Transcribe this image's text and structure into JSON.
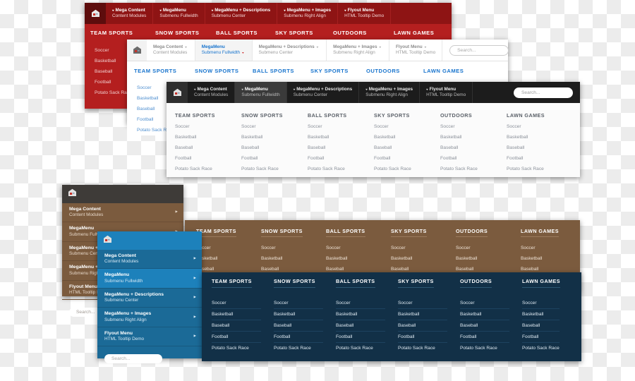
{
  "icons": {
    "home": "home-icon",
    "caret": "▾",
    "arrow": "►"
  },
  "top_items": [
    {
      "t1": "Mega Content",
      "t2": "Content Modules"
    },
    {
      "t1": "MegaMenu",
      "t2": "Submenu Fullwidth"
    },
    {
      "t1": "MegaMenu + Descriptions",
      "t2": "Submenu Center"
    },
    {
      "t1": "MegaMenu + Images",
      "t2": "Submenu Right Align"
    },
    {
      "t1": "Flyout Menu",
      "t2": "HTML Tooltip Demo"
    }
  ],
  "categories": [
    "TEAM SPORTS",
    "SNOW SPORTS",
    "BALL SPORTS",
    "SKY SPORTS",
    "OUTDOORS",
    "LAWN GAMES"
  ],
  "links": [
    "Soccer",
    "Basketball",
    "Baseball",
    "Football",
    "Potato Sack Race"
  ],
  "search": {
    "placeholder": "Search...",
    "label": "Search..."
  },
  "colors": {
    "red": "#b41f1f",
    "red_dark": "#8e1414",
    "blue_link": "#1874cd",
    "dark": "#1c1c1c",
    "brown": "#7b5b3e",
    "navy": "#123047",
    "blue_panel": "#1b6a97"
  },
  "panels": {
    "red": {
      "name": "red-megamenu-panel"
    },
    "white": {
      "name": "white-megamenu-panel"
    },
    "dark": {
      "name": "dark-megamenu-panel"
    },
    "brown_vertical": {
      "name": "brown-vertical-menu"
    },
    "blue_vertical": {
      "name": "blue-vertical-menu"
    },
    "brown_mega": {
      "name": "brown-mega-panel"
    },
    "navy_mega": {
      "name": "navy-mega-panel"
    }
  }
}
